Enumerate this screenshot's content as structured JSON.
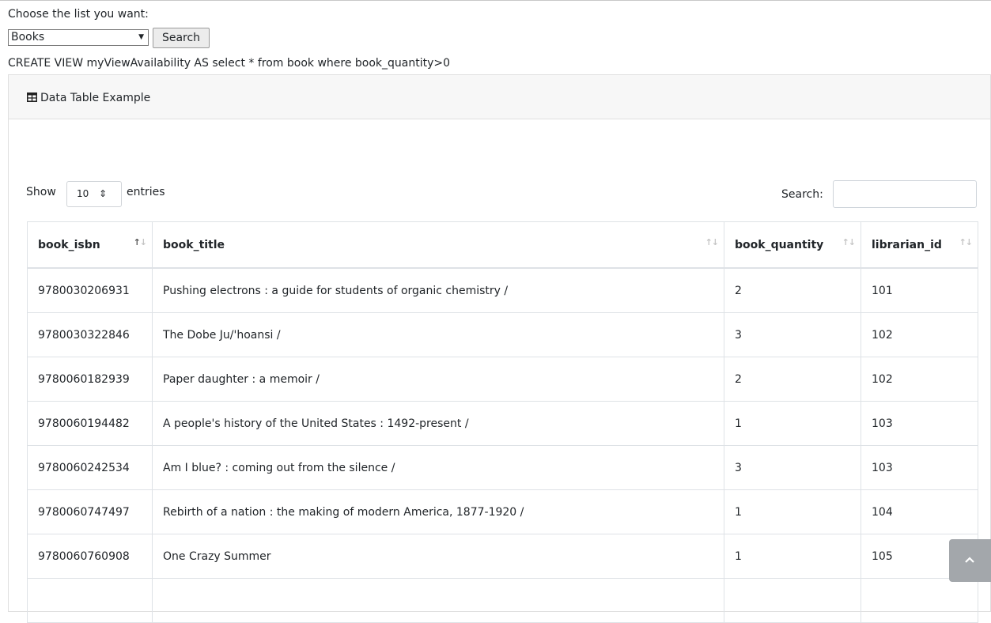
{
  "form": {
    "choose_label": "Choose the list you want:",
    "select_value": "Books",
    "search_button": "Search"
  },
  "sql_text": "CREATE VIEW myViewAvailability AS select * from book where book_quantity>0",
  "card": {
    "title": "Data Table Example",
    "icon": "table-icon"
  },
  "datatable": {
    "show_label": "Show",
    "length_value": "10",
    "entries_label": "entries",
    "search_label": "Search:",
    "search_value": "",
    "columns": [
      "book_isbn",
      "book_title",
      "book_quantity",
      "librarian_id"
    ],
    "rows": [
      [
        "9780030206931",
        "Pushing electrons : a guide for students of organic chemistry /",
        "2",
        "101"
      ],
      [
        "9780030322846",
        "The Dobe Ju/'hoansi /",
        "3",
        "102"
      ],
      [
        "9780060182939",
        "Paper daughter : a memoir /",
        "2",
        "102"
      ],
      [
        "9780060194482",
        "A people's history of the United States : 1492-present /",
        "1",
        "103"
      ],
      [
        "9780060242534",
        "Am I blue? : coming out from the silence /",
        "3",
        "103"
      ],
      [
        "9780060747497",
        "Rebirth of a nation : the making of modern America, 1877-1920 /",
        "1",
        "104"
      ],
      [
        "9780060760908",
        "One Crazy Summer",
        "1",
        "105"
      ],
      [
        "",
        "",
        "",
        ""
      ]
    ]
  },
  "icons": {
    "sort": "sort-icon",
    "scroll_top": "chevron-up-icon"
  },
  "colors": {
    "card_header_bg": "#f7f7f7",
    "border": "#dee2e6",
    "scroll_top_bg": "#a3a7ab"
  }
}
